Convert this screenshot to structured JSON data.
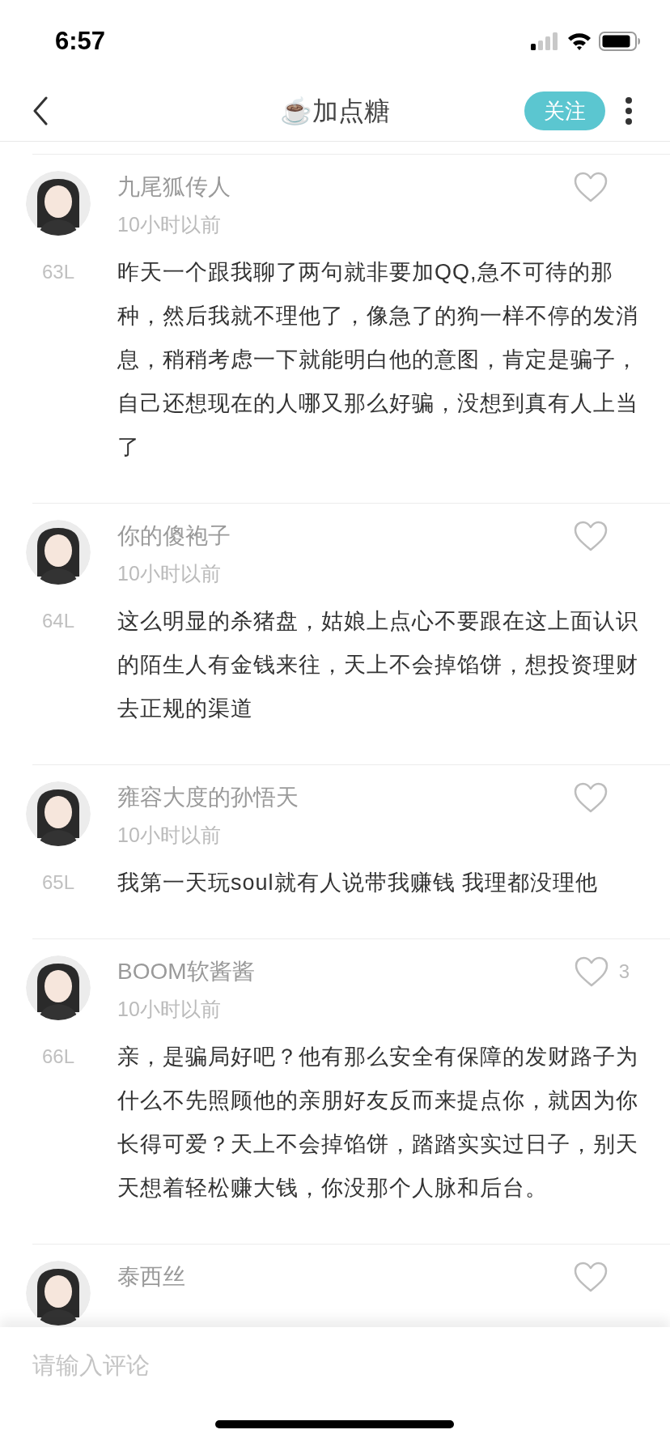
{
  "status_bar": {
    "time": "6:57"
  },
  "nav": {
    "title": "☕加点糖",
    "follow_button": "关注"
  },
  "comments": [
    {
      "name": "九尾狐传人",
      "time": "10小时以前",
      "floor": "63L",
      "text": "昨天一个跟我聊了两句就非要加QQ,急不可待的那种，然后我就不理他了，像急了的狗一样不停的发消息，稍稍考虑一下就能明白他的意图，肯定是骗子，自己还想现在的人哪又那么好骗，没想到真有人上当了"
    },
    {
      "name": "你的傻袍子",
      "time": "10小时以前",
      "floor": "64L",
      "text": "这么明显的杀猪盘，姑娘上点心不要跟在这上面认识的陌生人有金钱来往，天上不会掉馅饼，想投资理财去正规的渠道"
    },
    {
      "name": "雍容大度的孙悟天",
      "time": "10小时以前",
      "floor": "65L",
      "text": "我第一天玩soul就有人说带我赚钱 我理都没理他"
    },
    {
      "name": "BOOM软酱酱",
      "time": "10小时以前",
      "floor": "66L",
      "likes": "3",
      "text": "亲，是骗局好吧？他有那么安全有保障的发财路子为什么不先照顾他的亲朋好友反而来提点你，就因为你长得可爱？天上不会掉馅饼，踏踏实实过日子，别天天想着轻松赚大钱，你没那个人脉和后台。"
    },
    {
      "name": "泰西丝"
    }
  ],
  "comment_input": {
    "placeholder": "请输入评论"
  }
}
